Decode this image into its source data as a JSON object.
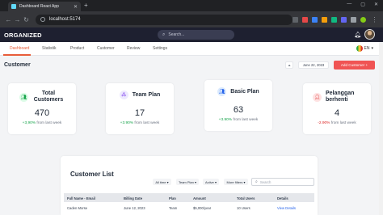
{
  "browser": {
    "tab_title": "Dashboard React App",
    "url": "localhost:5174"
  },
  "app": {
    "logo": "ORGANIZED",
    "search_placeholder": "Search...",
    "language": "EN"
  },
  "nav_tabs": [
    {
      "label": "Dashboard",
      "active": true
    },
    {
      "label": "Statistik",
      "active": false
    },
    {
      "label": "Product",
      "active": false
    },
    {
      "label": "Customer",
      "active": false
    },
    {
      "label": "Review",
      "active": false
    },
    {
      "label": "Settings",
      "active": false
    }
  ],
  "page": {
    "title": "Customer",
    "date": "June 22, 2023",
    "add_button": "Add Customer +"
  },
  "cards": [
    {
      "title": "Total Customers",
      "value": "470",
      "delta": "+3,90%",
      "delta_suffix": "from last week",
      "icon": "users-icon",
      "trend": "up"
    },
    {
      "title": "Team Plan",
      "value": "17",
      "delta": "+3.90%",
      "delta_suffix": "from last week",
      "icon": "team-icon",
      "trend": "up"
    },
    {
      "title": "Basic Plan",
      "value": "63",
      "delta": "+3.90%",
      "delta_suffix": "from last week",
      "icon": "user-group-icon",
      "trend": "up"
    },
    {
      "title": "Pelanggan berhenti",
      "value": "4",
      "delta": "-2.90%",
      "delta_suffix": "from last week",
      "icon": "user-stop-icon",
      "trend": "down"
    }
  ],
  "customer_list": {
    "title": "Customer List",
    "filters": [
      "All time ▾",
      "Team Plan ▾",
      "Active ▾",
      "More filters ▾"
    ],
    "search_placeholder": "Search",
    "columns": [
      "Full Name - Email",
      "Billing Date",
      "Plan",
      "Amount",
      "Total Users",
      "Details"
    ],
    "rows": [
      [
        "Caden Morse",
        "June 12, 2023",
        "Team",
        "$5,000/year",
        "10 Users",
        "View Details"
      ]
    ]
  },
  "colors": {
    "accent": "#e85d3a",
    "add_button": "#f05454",
    "header_bg": "#1e2030",
    "positive": "#16a34a",
    "negative": "#dc2626"
  }
}
